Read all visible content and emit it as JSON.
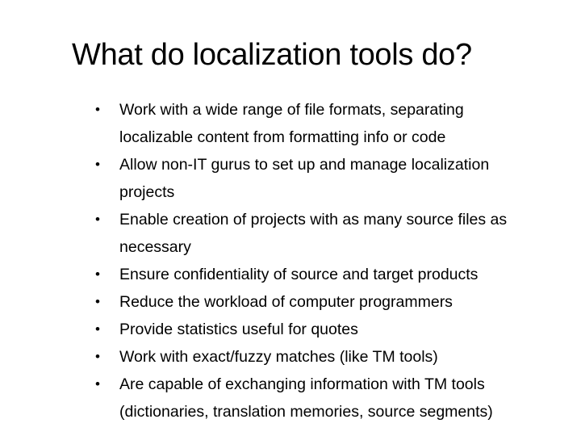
{
  "slide": {
    "title": "What do localization tools do?",
    "bullets": [
      {
        "lines": [
          "Work with a wide range of file formats, separating",
          "localizable content from formatting info or code"
        ]
      },
      {
        "lines": [
          "Allow non-IT gurus to set up and manage localization",
          "projects"
        ]
      },
      {
        "lines": [
          "Enable creation of projects with as many source files as",
          "necessary"
        ]
      },
      {
        "lines": [
          "Ensure confidentiality of source and target products"
        ]
      },
      {
        "lines": [
          "Reduce the workload of computer programmers"
        ]
      },
      {
        "lines": [
          "Provide statistics useful for quotes"
        ]
      },
      {
        "lines": [
          "Work with exact/fuzzy matches (like TM tools)"
        ]
      },
      {
        "lines": [
          "Are capable of exchanging information with TM tools",
          "(dictionaries, translation memories, source segments)"
        ]
      }
    ],
    "bullet_glyph": "•"
  }
}
